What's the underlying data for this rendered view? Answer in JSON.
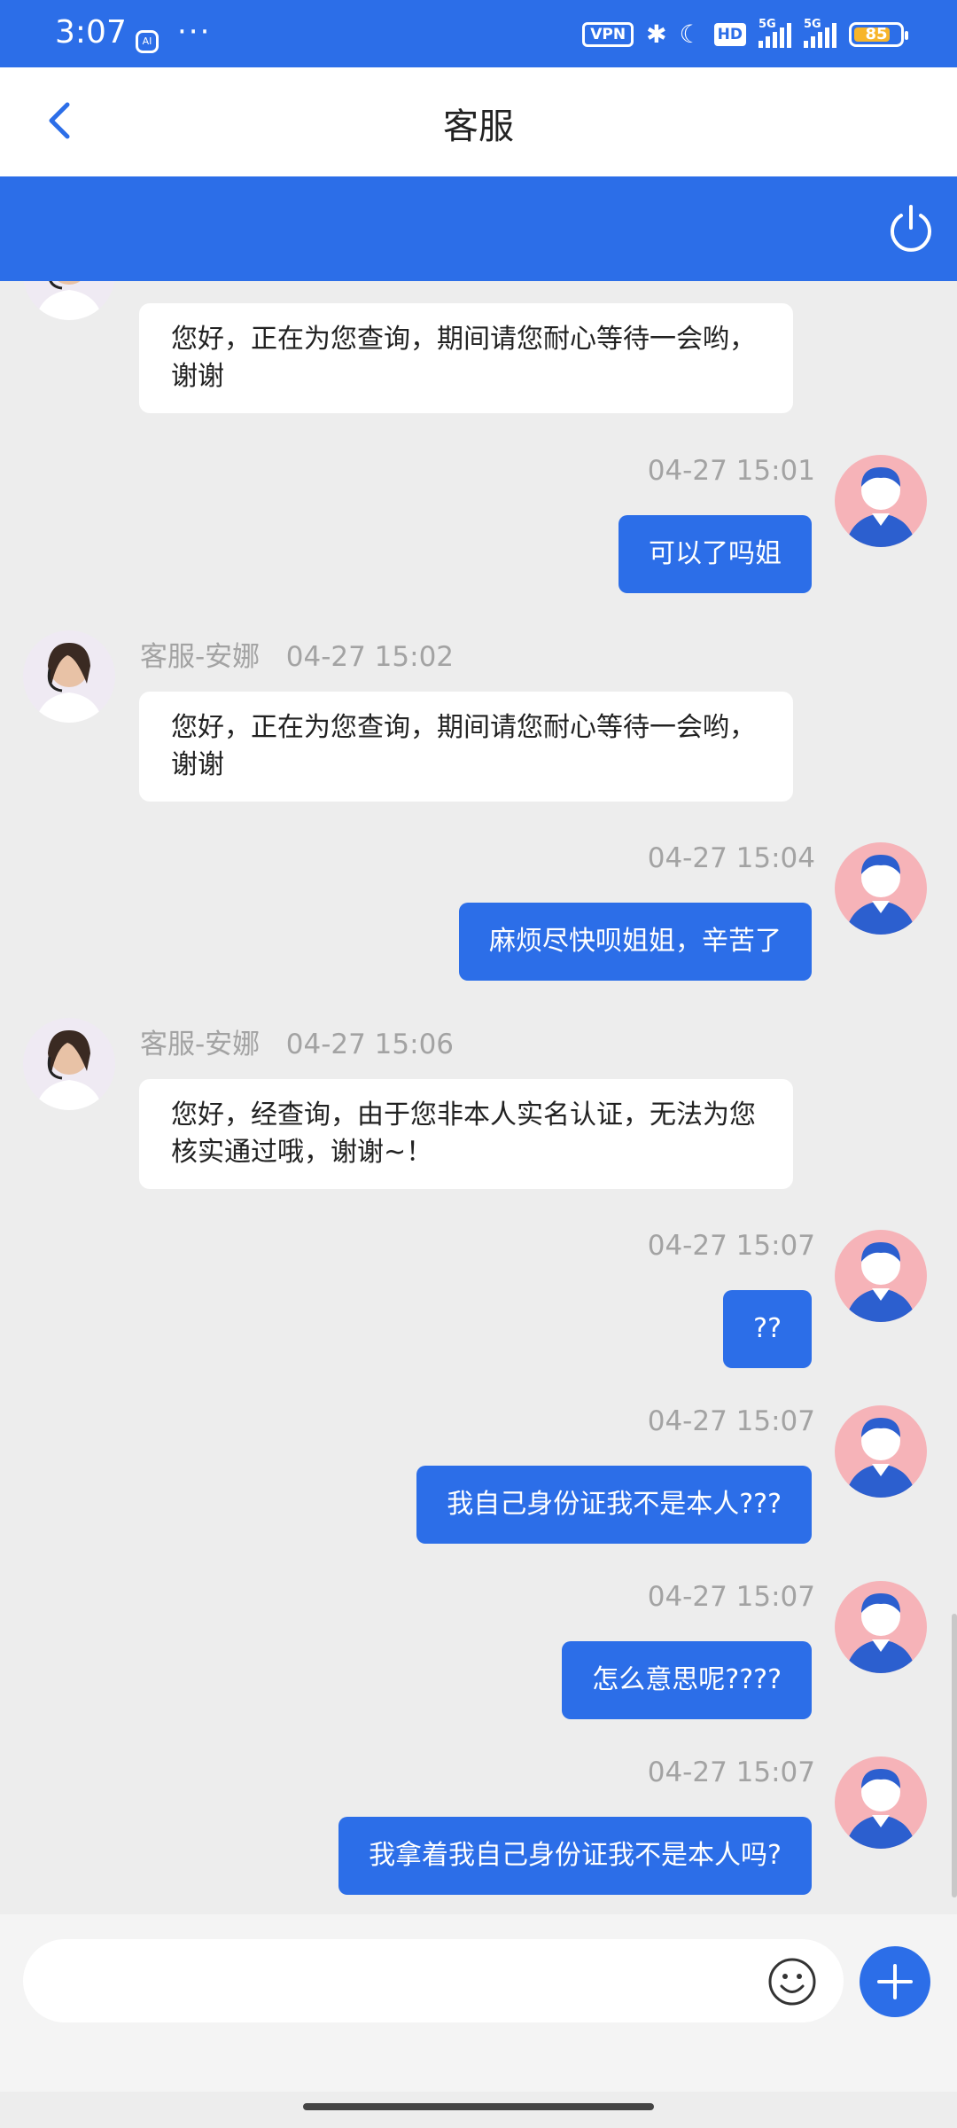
{
  "status": {
    "time": "3:07",
    "ai_badge": "AI",
    "more": "···",
    "vpn": "VPN",
    "bluetooth": "✱",
    "moon": "☾",
    "hd": "HD",
    "net1": "5G",
    "net2": "5G",
    "battery": "85"
  },
  "header": {
    "title": "客服"
  },
  "messages": [
    {
      "side": "agent",
      "text": "您好，正在为您查询，期间请您耐心等待一会哟，谢谢"
    },
    {
      "side": "user",
      "time": "04-27 15:01",
      "text": "可以了吗姐"
    },
    {
      "side": "agent",
      "sender": "客服-安娜",
      "time": "04-27 15:02",
      "text": "您好，正在为您查询，期间请您耐心等待一会哟，谢谢"
    },
    {
      "side": "user",
      "time": "04-27 15:04",
      "text": "麻烦尽快呗姐姐，辛苦了"
    },
    {
      "side": "agent",
      "sender": "客服-安娜",
      "time": "04-27 15:06",
      "text": "您好，经查询，由于您非本人实名认证，无法为您核实通过哦，谢谢~！"
    },
    {
      "side": "user",
      "time": "04-27 15:07",
      "text": "??"
    },
    {
      "side": "user",
      "time": "04-27 15:07",
      "text": "我自己身份证我不是本人???"
    },
    {
      "side": "user",
      "time": "04-27 15:07",
      "text": "怎么意思呢????"
    },
    {
      "side": "user",
      "time": "04-27 15:07",
      "text": "我拿着我自己身份证我不是本人吗?"
    }
  ],
  "input": {
    "placeholder": ""
  },
  "colors": {
    "primary": "#2c6ee8",
    "background": "#ededed",
    "user_avatar": "#f6b3b8"
  }
}
